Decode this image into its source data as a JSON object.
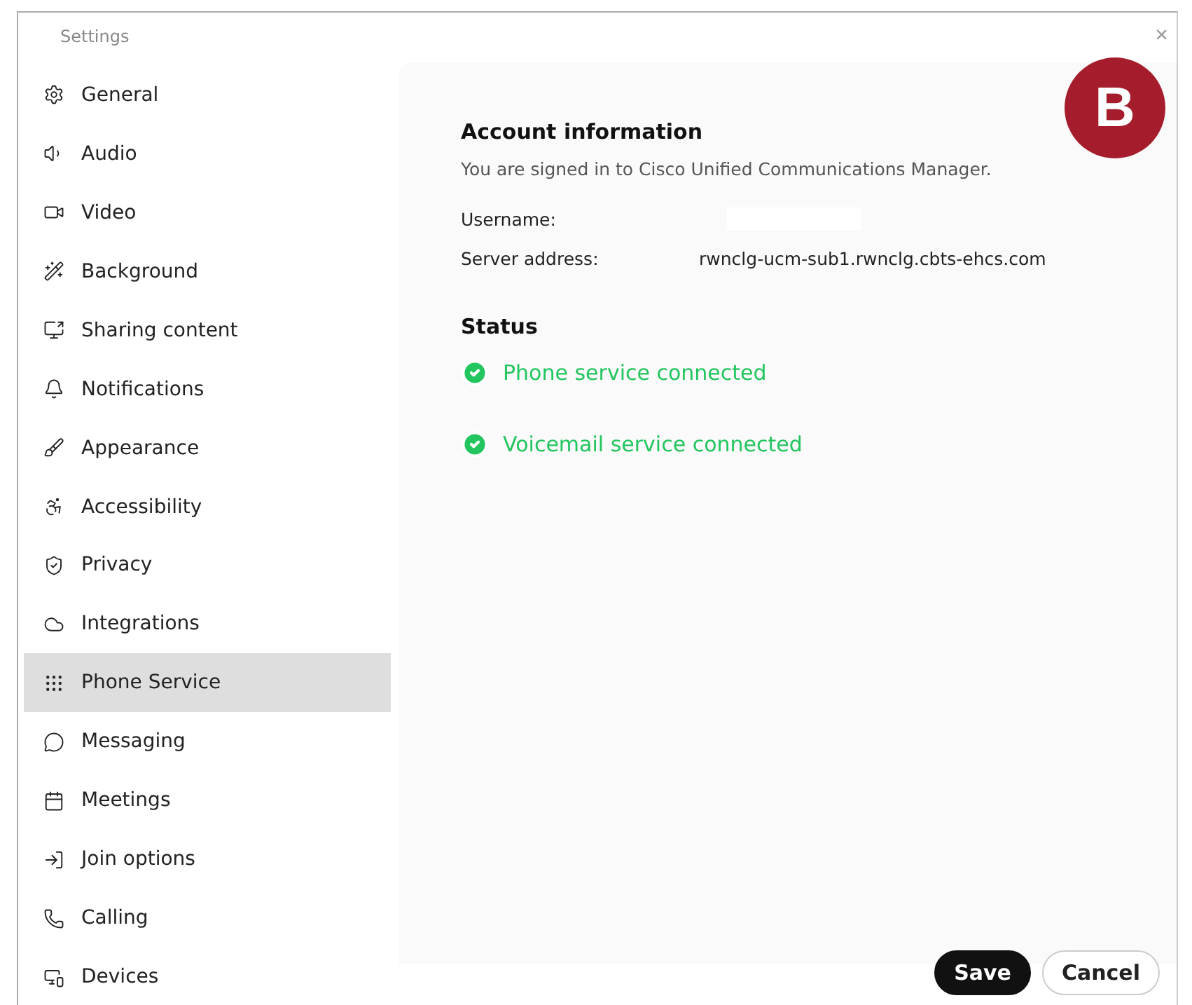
{
  "window": {
    "title": "Settings",
    "close": "×"
  },
  "badge": "B",
  "sidebar": {
    "items": [
      {
        "label": "General",
        "selected": false
      },
      {
        "label": "Audio",
        "selected": false
      },
      {
        "label": "Video",
        "selected": false
      },
      {
        "label": "Background",
        "selected": false
      },
      {
        "label": "Sharing content",
        "selected": false
      },
      {
        "label": "Notifications",
        "selected": false
      },
      {
        "label": "Appearance",
        "selected": false
      },
      {
        "label": "Accessibility",
        "selected": false
      },
      {
        "label": "Privacy",
        "selected": false
      },
      {
        "label": "Integrations",
        "selected": false
      },
      {
        "label": "Phone Service",
        "selected": true
      },
      {
        "label": "Messaging",
        "selected": false
      },
      {
        "label": "Meetings",
        "selected": false
      },
      {
        "label": "Join options",
        "selected": false
      },
      {
        "label": "Calling",
        "selected": false
      },
      {
        "label": "Devices",
        "selected": false
      }
    ]
  },
  "account": {
    "heading": "Account information",
    "description": "You are signed in to Cisco Unified Communications Manager.",
    "fields": [
      {
        "label": "Username:",
        "redacted": true
      },
      {
        "label": "Server address:",
        "value": "rwnclg-ucm-sub1.rwnclg.cbts-ehcs.com",
        "redacted": false
      }
    ]
  },
  "status": {
    "heading": "Status",
    "items": [
      {
        "label": "Phone service connected",
        "connected": true
      },
      {
        "label": "Voicemail service connected",
        "connected": true
      }
    ]
  },
  "buttons": [
    {
      "label": "Save",
      "kind": "primary"
    },
    {
      "label": "Cancel",
      "kind": "secondary"
    }
  ]
}
